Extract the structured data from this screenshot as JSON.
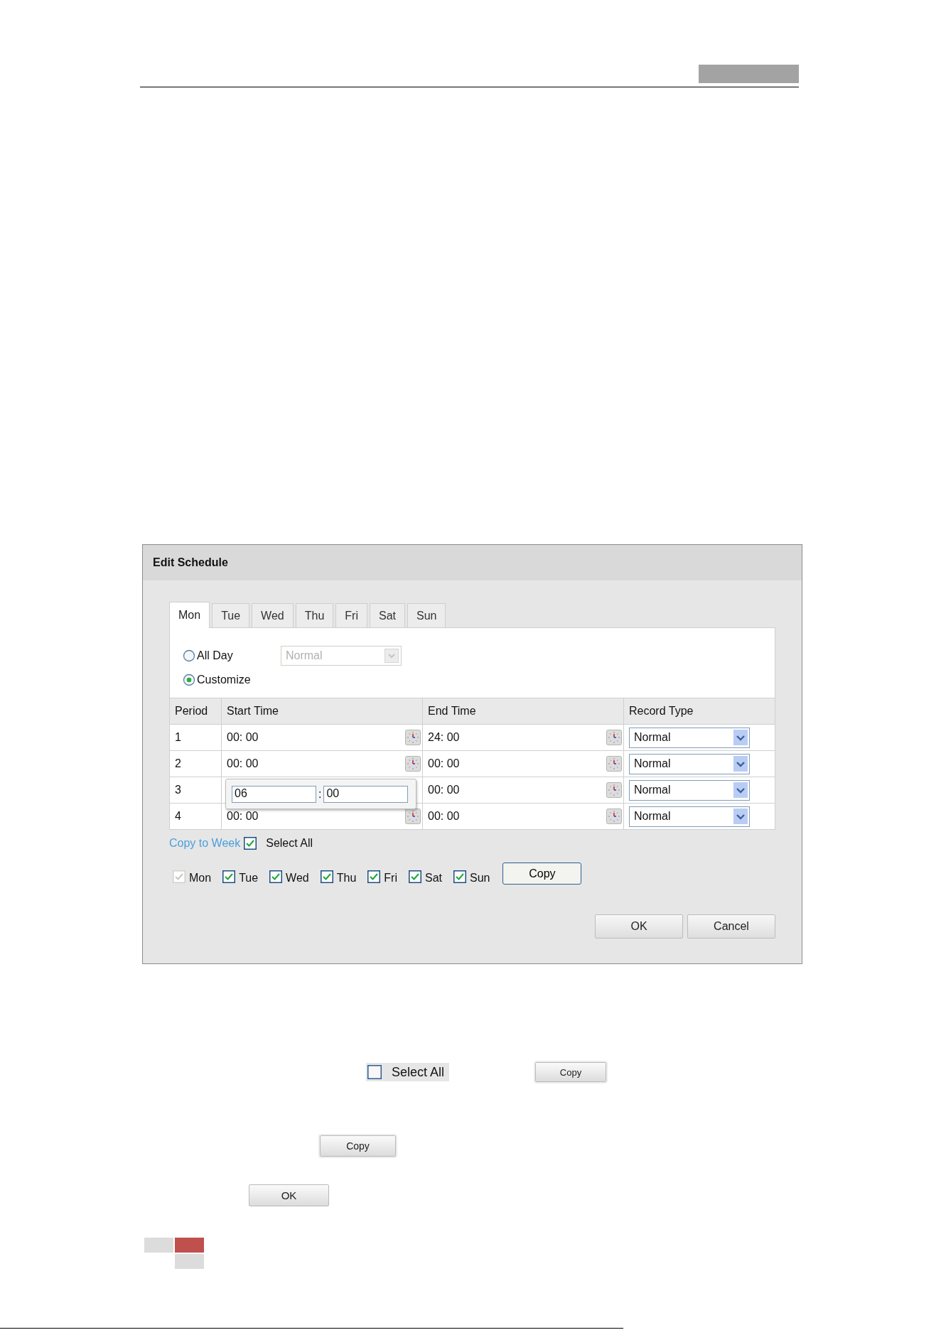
{
  "dialog": {
    "title": "Edit Schedule",
    "tabs": [
      {
        "label": "Mon",
        "selected": true
      },
      {
        "label": "Tue",
        "selected": false
      },
      {
        "label": "Wed",
        "selected": false
      },
      {
        "label": "Thu",
        "selected": false
      },
      {
        "label": "Fri",
        "selected": false
      },
      {
        "label": "Sat",
        "selected": false
      },
      {
        "label": "Sun",
        "selected": false
      }
    ],
    "mode_options": [
      {
        "label": "All Day",
        "selected": false
      },
      {
        "label": "Customize",
        "selected": true
      }
    ],
    "all_day_type": {
      "value": "Normal",
      "disabled": true
    },
    "table": {
      "columns": [
        "Period",
        "Start Time",
        "End Time",
        "Record Type"
      ],
      "rows": [
        {
          "period": "1",
          "start_time": "00: 00",
          "end_time": "24: 00",
          "record_type": "Normal"
        },
        {
          "period": "2",
          "start_time": "00: 00",
          "end_time": "00: 00",
          "record_type": "Normal"
        },
        {
          "period": "3",
          "time_editor": {
            "hours": "06",
            "separator": ":",
            "minutes": "00"
          },
          "end_time": "00: 00",
          "record_type": "Normal"
        },
        {
          "period": "4",
          "start_time": "00: 00",
          "end_time": "00: 00",
          "record_type": "Normal"
        }
      ]
    },
    "copy_to_week": {
      "link": "Copy to Week",
      "select_all": {
        "label": "Select All",
        "checked": true
      },
      "days": [
        {
          "label": "Mon",
          "checked": true,
          "disabled": true
        },
        {
          "label": "Tue",
          "checked": true,
          "disabled": false
        },
        {
          "label": "Wed",
          "checked": true,
          "disabled": false
        },
        {
          "label": "Thu",
          "checked": true,
          "disabled": false
        },
        {
          "label": "Fri",
          "checked": true,
          "disabled": false
        },
        {
          "label": "Sat",
          "checked": true,
          "disabled": false
        },
        {
          "label": "Sun",
          "checked": true,
          "disabled": false
        }
      ],
      "copy_button": "Copy"
    },
    "buttons": [
      "OK",
      "Cancel"
    ]
  },
  "snippets": {
    "select_all": {
      "label": "Select All",
      "checked": false
    },
    "copy_buttons": [
      "Copy",
      "Copy"
    ],
    "ok_button": "OK"
  }
}
